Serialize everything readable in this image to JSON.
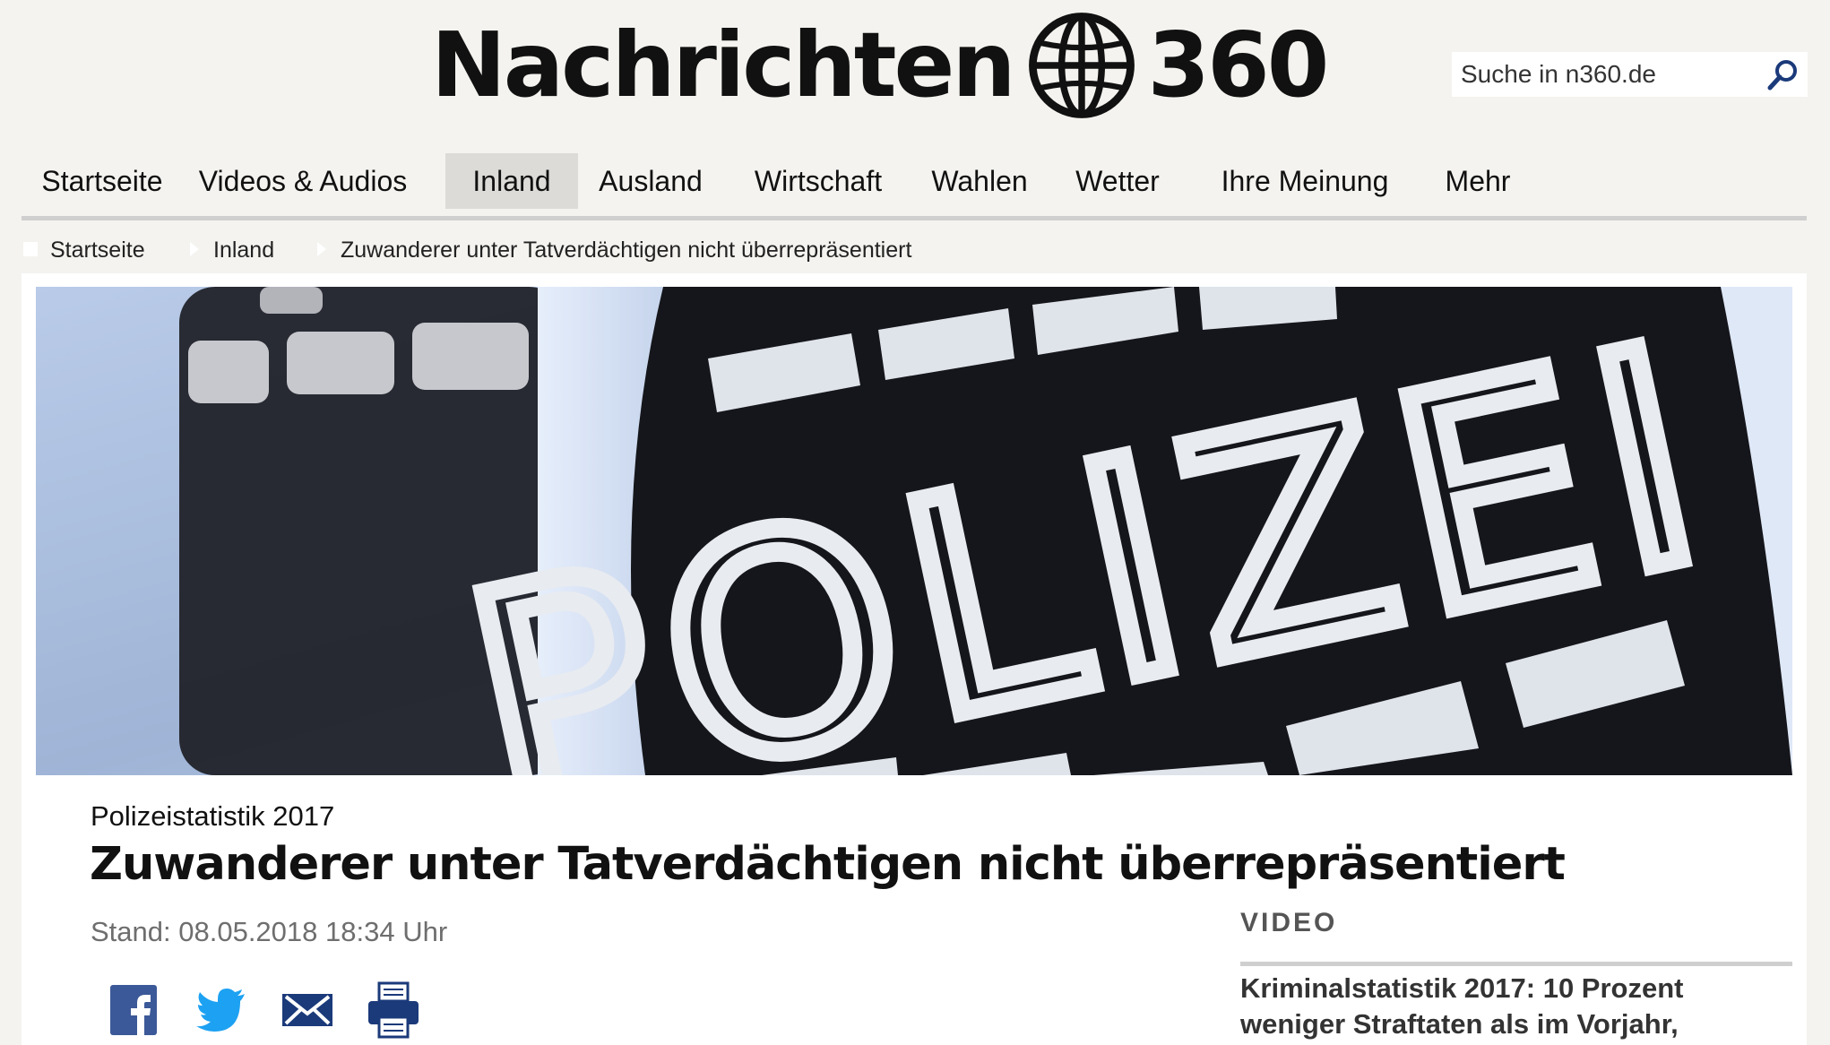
{
  "header": {
    "logo_left": "Nachrichten",
    "logo_right": "360",
    "logo_icon": "globe-icon",
    "search_placeholder": "Suche in n360.de",
    "search_icon": "search-icon"
  },
  "nav": {
    "items": [
      {
        "label": "Startseite",
        "active": false
      },
      {
        "label": "Videos & Audios",
        "active": false
      },
      {
        "label": "Inland",
        "active": true
      },
      {
        "label": "Ausland",
        "active": false
      },
      {
        "label": "Wirtschaft",
        "active": false
      },
      {
        "label": "Wahlen",
        "active": false
      },
      {
        "label": "Wetter",
        "active": false
      },
      {
        "label": "Ihre Meinung",
        "active": false
      },
      {
        "label": "Mehr",
        "active": false
      }
    ]
  },
  "breadcrumb": [
    "Startseite",
    "Inland",
    "Zuwanderer unter Tatverdächtigen nicht überrepräsentiert"
  ],
  "article": {
    "hero_text": "POLIZEI",
    "kicker": "Polizeistatistik 2017",
    "headline": "Zuwanderer unter Tatverdächtigen nicht überrepräsentiert",
    "timestamp": "Stand: 08.05.2018 18:34 Uhr",
    "share_icons": [
      "facebook-icon",
      "twitter-icon",
      "mail-icon",
      "print-icon"
    ]
  },
  "sidebar": {
    "label": "VIDEO",
    "video_title_line1": "Kriminalstatistik 2017: 10 Prozent",
    "video_title_line2": "weniger Straftaten als im Vorjahr,"
  },
  "colors": {
    "page_bg": "#f4f3ef",
    "nav_active_bg": "#dcdbd7",
    "search_icon": "#1b3a7a",
    "facebook": "#3b5998",
    "twitter": "#1da1f2",
    "mail": "#1b3a7a",
    "print": "#1b3a7a"
  }
}
